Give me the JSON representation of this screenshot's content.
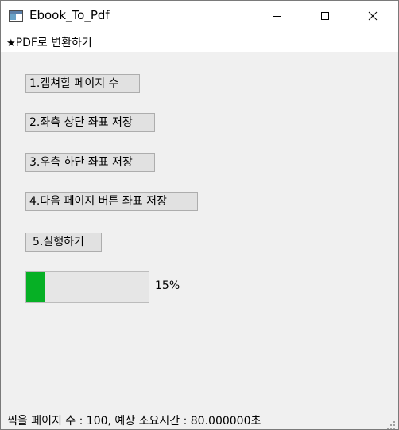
{
  "window": {
    "title": "Ebook_To_Pdf",
    "icon": "app-window-icon",
    "controls": [
      "minimize-icon",
      "maximize-icon",
      "close-icon"
    ]
  },
  "menu": {
    "items": [
      {
        "star": "★",
        "label": "PDF로 변환하기"
      }
    ]
  },
  "buttons": {
    "capture_pages": "1.캡쳐할 페이지 수",
    "save_top_left": "2.좌측 상단 좌표 저장",
    "save_bottom_right": "3.우측 하단 좌표 저장",
    "save_next_button": "4.다음 페이지 버튼 좌표 저장",
    "run": "5.실행하기"
  },
  "progress": {
    "value": 15,
    "label": "15%",
    "fill_color": "#06b025"
  },
  "status": {
    "text": "찍을 페이지 수 : 100, 예상 소요시간 : 80.000000초"
  }
}
